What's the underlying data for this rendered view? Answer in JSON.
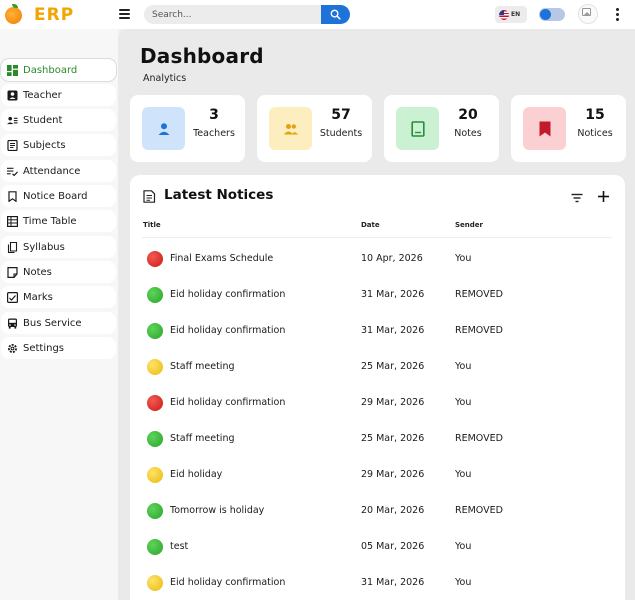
{
  "app": {
    "logo_text": "ERP"
  },
  "search": {
    "placeholder": "Search..."
  },
  "language": {
    "code": "EN"
  },
  "sidebar": {
    "items": [
      {
        "label": "Dashboard",
        "icon": "dashboard-icon",
        "active": true
      },
      {
        "label": "Teacher",
        "icon": "teacher-icon"
      },
      {
        "label": "Student",
        "icon": "student-icon"
      },
      {
        "label": "Subjects",
        "icon": "subjects-icon"
      },
      {
        "label": "Attendance",
        "icon": "attendance-icon"
      },
      {
        "label": "Notice Board",
        "icon": "notice-board-icon"
      },
      {
        "label": "Time Table",
        "icon": "time-table-icon"
      },
      {
        "label": "Syllabus",
        "icon": "syllabus-icon"
      },
      {
        "label": "Notes",
        "icon": "notes-icon"
      },
      {
        "label": "Marks",
        "icon": "marks-icon"
      },
      {
        "label": "Bus Service",
        "icon": "bus-icon"
      },
      {
        "label": "Settings",
        "icon": "settings-icon"
      }
    ]
  },
  "page": {
    "title": "Dashboard",
    "subtitle": "Analytics"
  },
  "stats": [
    {
      "count": "3",
      "label": "Teachers",
      "icon": "person-icon",
      "tile_color": "#cfe4fb",
      "icon_color": "#1e73d8"
    },
    {
      "count": "57",
      "label": "Students",
      "icon": "group-icon",
      "tile_color": "#fdeec0",
      "icon_color": "#e0a30e"
    },
    {
      "count": "20",
      "label": "Notes",
      "icon": "book-icon",
      "tile_color": "#c9f1d2",
      "icon_color": "#2a8a3e"
    },
    {
      "count": "15",
      "label": "Notices",
      "icon": "bookmark-icon",
      "tile_color": "#fbd0d3",
      "icon_color": "#c21a2a"
    }
  ],
  "notices": {
    "title": "Latest Notices",
    "columns": {
      "title": "Title",
      "date": "Date",
      "sender": "Sender"
    },
    "rows": [
      {
        "status": "red",
        "title": "Final Exams Schedule",
        "date": "10 Apr, 2026",
        "sender": "You"
      },
      {
        "status": "green",
        "title": "Eid holiday confirmation",
        "date": "31 Mar, 2026",
        "sender": "REMOVED"
      },
      {
        "status": "green",
        "title": "Eid holiday confirmation",
        "date": "31 Mar, 2026",
        "sender": "REMOVED"
      },
      {
        "status": "yellow",
        "title": "Staff meeting",
        "date": "25 Mar, 2026",
        "sender": "You"
      },
      {
        "status": "red",
        "title": "Eid holiday confirmation",
        "date": "29 Mar, 2026",
        "sender": "You"
      },
      {
        "status": "green",
        "title": "Staff meeting",
        "date": "25 Mar, 2026",
        "sender": "REMOVED"
      },
      {
        "status": "yellow",
        "title": "Eid holiday",
        "date": "29 Mar, 2026",
        "sender": "You"
      },
      {
        "status": "green",
        "title": "Tomorrow is holiday",
        "date": "20 Mar, 2026",
        "sender": "REMOVED"
      },
      {
        "status": "green",
        "title": "test",
        "date": "05 Mar, 2026",
        "sender": "You"
      },
      {
        "status": "yellow",
        "title": "Eid holiday confirmation",
        "date": "31 Mar, 2026",
        "sender": "You"
      }
    ]
  },
  "colors": {
    "accent": "#1e73d8",
    "active_nav": "#2a8a2a",
    "logo": "#f0a500"
  }
}
